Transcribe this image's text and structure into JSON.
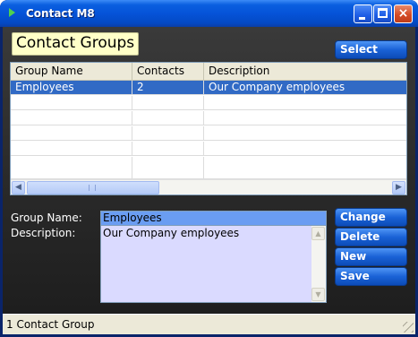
{
  "window": {
    "title": "Contact M8",
    "icon": "play-triangle-icon",
    "controls": {
      "minimize": "minimize-icon",
      "maximize": "maximize-icon",
      "close": "close-icon",
      "close_glyph": "×"
    }
  },
  "header": {
    "title": "Contact Groups",
    "select_label": "Select"
  },
  "grid": {
    "columns": [
      "Group Name",
      "Contacts",
      "Description"
    ],
    "rows": [
      {
        "group_name": "Employees",
        "contacts": "2",
        "description": "Our Company employees",
        "selected": true
      }
    ],
    "scroll": {
      "left_arrow": "◀",
      "right_arrow": "▶"
    }
  },
  "form": {
    "group_name_label": "Group Name:",
    "group_name_value": "Employees",
    "description_label": "Description:",
    "description_value": "Our Company employees",
    "scroll": {
      "up_arrow": "▲",
      "down_arrow": "▼"
    }
  },
  "actions": {
    "change_label": "Change",
    "delete_label": "Delete",
    "new_label": "New",
    "save_label": "Save"
  },
  "status": {
    "text": "1 Contact Group"
  },
  "colors": {
    "title_bar": "#0553d8",
    "heading_bg": "#ffffc8",
    "button_blue": "#1a62d6",
    "selection": "#316ac5",
    "name_field_bg": "#6a9df2",
    "description_field_bg": "#dadaff"
  }
}
